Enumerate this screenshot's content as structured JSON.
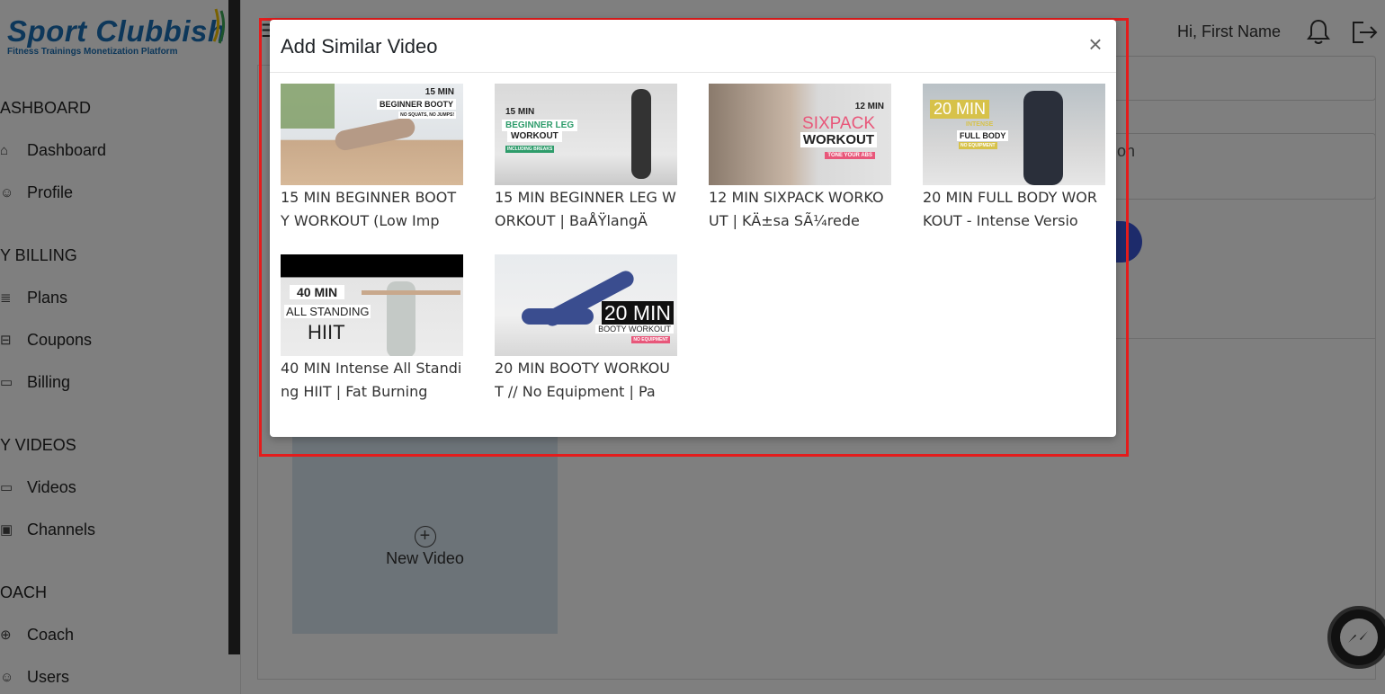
{
  "brand": {
    "name": "Sport Clubbish",
    "tagline": "Fitness Trainings Monetization Platform"
  },
  "sidebar": {
    "sections": [
      {
        "title": "ASHBOARD",
        "items": [
          {
            "label": "Dashboard",
            "icon": "home-icon"
          },
          {
            "label": "Profile",
            "icon": "user-icon"
          }
        ]
      },
      {
        "title": "Y BILLING",
        "items": [
          {
            "label": "Plans",
            "icon": "list-icon"
          },
          {
            "label": "Coupons",
            "icon": "ticket-icon"
          },
          {
            "label": "Billing",
            "icon": "card-icon"
          }
        ]
      },
      {
        "title": "Y VIDEOS",
        "items": [
          {
            "label": "Videos",
            "icon": "video-icon"
          },
          {
            "label": "Channels",
            "icon": "channel-icon"
          }
        ]
      },
      {
        "title": "OACH",
        "items": [
          {
            "label": "Coach",
            "icon": "globe-icon"
          },
          {
            "label": "Users",
            "icon": "users-icon"
          }
        ]
      }
    ]
  },
  "header": {
    "greeting": "Hi, First Name",
    "notification_icon": "bell-icon",
    "logout_icon": "logout-icon"
  },
  "content": {
    "field2_partial": "on",
    "new_video_label": "New Video",
    "new_video_icon": "plus-circle-icon"
  },
  "modal": {
    "title": "Add Similar Video",
    "close_label": "×",
    "videos": [
      {
        "title": "15 MIN BEGINNER BOOTY WORKOUT (Low Imp",
        "thumb_text": [
          "15 MIN",
          "BEGINNER BOOTY",
          "NO SQUATS, NO JUMPS!"
        ]
      },
      {
        "title": "15 MIN BEGINNER LEG WORKOUT | BaÅŸlangÄ",
        "thumb_text": [
          "15 MIN",
          "BEGINNER LEG",
          "WORKOUT",
          "INCLUDING BREAKS"
        ]
      },
      {
        "title": "12 MIN SIXPACK WORKOUT | KÄ±sa SÃ¼rede",
        "thumb_text": [
          "12 MIN",
          "SIXPACK",
          "WORKOUT",
          "TONE YOUR ABS"
        ]
      },
      {
        "title": "20 MIN FULL BODY WORKOUT - Intense Versio",
        "thumb_text": [
          "20 MIN",
          "INTENSE",
          "FULL BODY",
          "NO EQUIPMENT"
        ]
      },
      {
        "title": "40 MIN Intense All Standing HIIT | Fat Burning",
        "thumb_text": [
          "40 MIN",
          "ALL STANDING",
          "HIIT"
        ]
      },
      {
        "title": "20 MIN BOOTY WORKOUT // No Equipment | Pa",
        "thumb_text": [
          "20 MIN",
          "BOOTY WORKOUT",
          "NO EQUIPMENT"
        ]
      }
    ]
  },
  "colors": {
    "brand_blue": "#1a6fb5",
    "highlight_red": "#e41c1c",
    "accent_blue": "#3b57d6"
  }
}
